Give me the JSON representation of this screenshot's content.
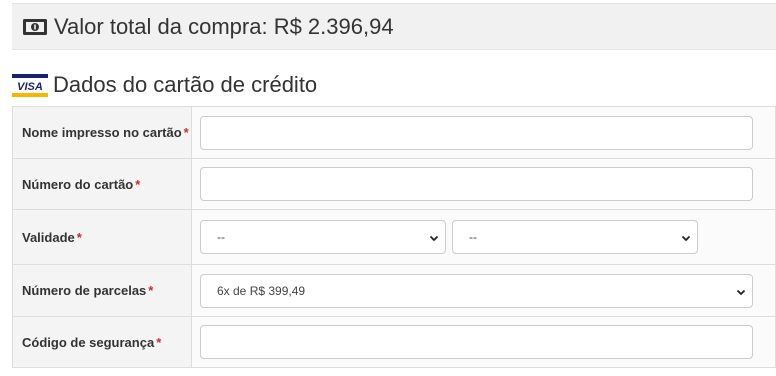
{
  "summary": {
    "total_label": "Valor total da compra: R$ 2.396,94",
    "icon": "money-bill-icon"
  },
  "card_section": {
    "title": "Dados do cartão de crédito",
    "icon": "visa-card-icon",
    "icon_text": "VISA"
  },
  "fields": {
    "name": {
      "label": "Nome impresso no cartão",
      "required_mark": "*",
      "value": ""
    },
    "number": {
      "label": "Número do cartão",
      "required_mark": "*",
      "value": ""
    },
    "expiry": {
      "label": "Validade",
      "required_mark": "*",
      "month_value": "--",
      "year_value": "--"
    },
    "installments": {
      "label": "Número de parcelas",
      "required_mark": "*",
      "value": "6x de R$ 399,49"
    },
    "cvv": {
      "label": "Código de segurança",
      "required_mark": "*",
      "value": ""
    }
  },
  "colors": {
    "required": "#c9302c",
    "visa_blue": "#1a1f71",
    "visa_gold": "#f7b600"
  }
}
